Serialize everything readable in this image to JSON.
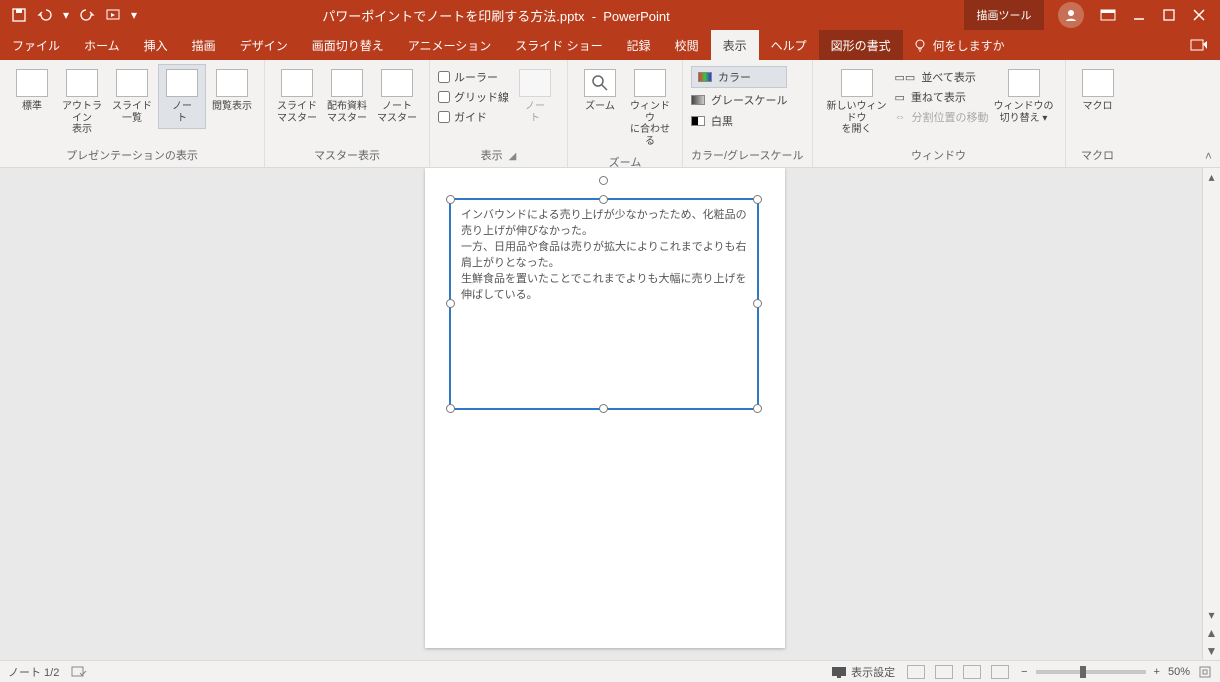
{
  "title": {
    "filename": "パワーポイントでノートを印刷する方法.pptx",
    "app": "PowerPoint",
    "context_tab_title": "描画ツール"
  },
  "tabs": {
    "file": "ファイル",
    "home": "ホーム",
    "insert": "挿入",
    "draw": "描画",
    "design": "デザイン",
    "transitions": "画面切り替え",
    "animations": "アニメーション",
    "slideshow": "スライド ショー",
    "record": "記録",
    "review": "校閲",
    "view": "表示",
    "help": "ヘルプ",
    "format": "図形の書式",
    "tellme": "何をしますか"
  },
  "ribbon": {
    "presentation_views": {
      "label": "プレゼンテーションの表示",
      "normal": "標準",
      "outline": "アウトライン\n表示",
      "sorter": "スライド\n一覧",
      "notes": "ノー\nト",
      "reading": "閲覧表示"
    },
    "master_views": {
      "label": "マスター表示",
      "slide": "スライド\nマスター",
      "handout": "配布資料\nマスター",
      "notes": "ノート\nマスター"
    },
    "show": {
      "label": "表示",
      "ruler": "ルーラー",
      "grid": "グリッド線",
      "guides": "ガイド",
      "notes_btn": "ノー\nト"
    },
    "zoom": {
      "label": "ズーム",
      "zoom": "ズーム",
      "fit": "ウィンドウ\nに合わせる"
    },
    "color": {
      "label": "カラー/グレースケール",
      "color": "カラー",
      "gray": "グレースケール",
      "bw": "白黒"
    },
    "window": {
      "label": "ウィンドウ",
      "new": "新しいウィンドウ\nを開く",
      "arrange": "並べて表示",
      "cascade": "重ねて表示",
      "split": "分割位置の移動",
      "switch": "ウィンドウの\n切り替え ▾"
    },
    "macros": {
      "label": "マクロ",
      "macro": "マクロ"
    }
  },
  "note": {
    "text": "インバウンドによる売り上げが少なかったため、化粧品の売り上げが伸びなかった。\n一方、日用品や食品は売りが拡大によりこれまでよりも右肩上がりとなった。\n生鮮食品を置いたことでこれまでよりも大幅に売り上げを伸ばしている。"
  },
  "status": {
    "page": "ノート 1/2",
    "display_settings": "表示設定",
    "zoom": "50%"
  }
}
